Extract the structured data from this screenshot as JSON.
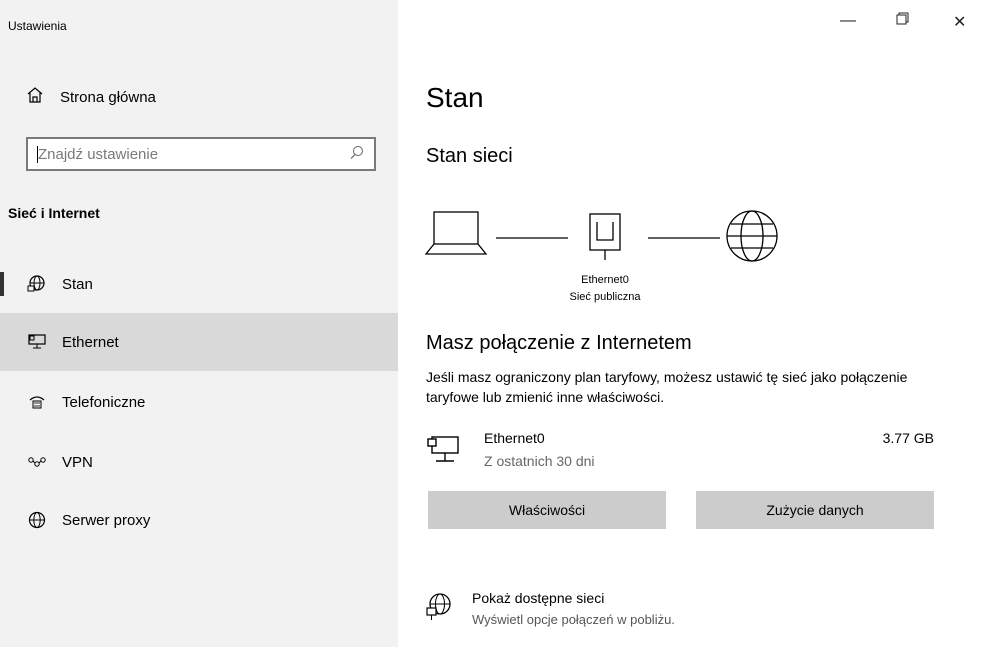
{
  "app": {
    "title": "Ustawienia"
  },
  "sidebar": {
    "home_label": "Strona główna",
    "search_placeholder": "Znajdź ustawienie",
    "section_title": "Sieć i Internet",
    "items": [
      {
        "label": "Stan",
        "icon": "globe-network-icon",
        "selected": true
      },
      {
        "label": "Ethernet",
        "icon": "ethernet-icon",
        "hover": true
      },
      {
        "label": "Telefoniczne",
        "icon": "dialup-icon"
      },
      {
        "label": "VPN",
        "icon": "vpn-icon"
      },
      {
        "label": "Serwer proxy",
        "icon": "globe-icon"
      }
    ]
  },
  "window_controls": {
    "minimize": "—",
    "restore": "🗗",
    "close": "✕"
  },
  "main": {
    "title": "Stan",
    "network_status_title": "Stan sieci",
    "diagram": {
      "adapter_name": "Ethernet0",
      "network_type": "Sieć publiczna"
    },
    "connected_title": "Masz połączenie z Internetem",
    "connected_desc": "Jeśli masz ograniczony plan taryfowy, możesz ustawić tę sieć jako połączenie taryfowe lub zmienić inne właściwości.",
    "adapter": {
      "name": "Ethernet0",
      "period": "Z ostatnich 30 dni",
      "usage": "3.77 GB"
    },
    "buttons": {
      "properties": "Właściwości",
      "data_usage": "Zużycie danych"
    },
    "show_networks": {
      "title": "Pokaż dostępne sieci",
      "subtitle": "Wyświetl opcje połączeń w pobliżu."
    }
  }
}
